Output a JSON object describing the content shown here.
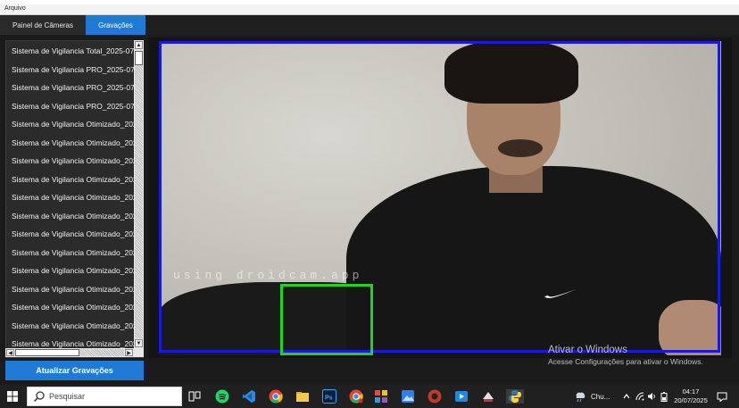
{
  "menu": {
    "arquivo": "Arquivo"
  },
  "tabs": [
    {
      "label": "Painel de Câmeras",
      "active": false
    },
    {
      "label": "Gravações",
      "active": true
    }
  ],
  "recordings": [
    "Sistema de Vigilancia Total_2025-07",
    "Sistema de Vigilancia PRO_2025-07",
    "Sistema de Vigilancia PRO_2025-07",
    "Sistema de Vigilancia PRO_2025-07",
    "Sistema de Vigilancia Otimizado_202",
    "Sistema de Vigilancia Otimizado_202",
    "Sistema de Vigilancia Otimizado_202",
    "Sistema de Vigilancia Otimizado_202",
    "Sistema de Vigilancia Otimizado_202",
    "Sistema de Vigilancia Otimizado_202",
    "Sistema de Vigilancia Otimizado_202",
    "Sistema de Vigilancia Otimizado_202",
    "Sistema de Vigilancia Otimizado_202",
    "Sistema de Vigilancia Otimizado_202",
    "Sistema de Vigilancia Otimizado_202",
    "Sistema de Vigilancia Otimizado_202",
    "Sistema de Vigilancia Otimizado_202"
  ],
  "refresh_button": "Atualizar Gravações",
  "video": {
    "watermark": "using droidcam.app",
    "person_box_color": "#1a1ad8",
    "motion_box_color": "#1fd31f"
  },
  "activation": {
    "title": "Ativar o Windows",
    "subtitle": "Acesse Configurações para ativar o Windows."
  },
  "taskbar": {
    "search_placeholder": "Pesquisar",
    "weather": "Chu...",
    "time": "04:17",
    "date": "20/07/2025",
    "accent": "#1f7ad6"
  }
}
